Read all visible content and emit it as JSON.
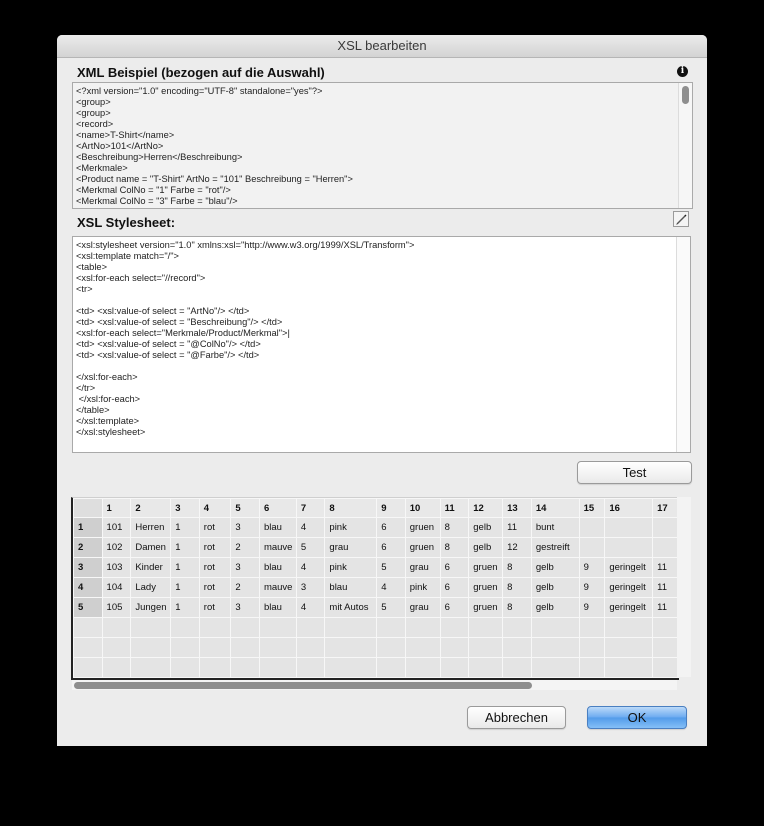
{
  "window": {
    "title": "XSL bearbeiten"
  },
  "xml_section": {
    "label": "XML Beispiel (bezogen auf die Auswahl)",
    "info_icon": "info-icon",
    "lines": [
      "<?xml version=\"1.0\" encoding=\"UTF-8\" standalone=\"yes\"?>",
      "<group>",
      "<group>",
      "<record>",
      "<name>T-Shirt</name>",
      "<ArtNo>101</ArtNo>",
      "<Beschreibung>Herren</Beschreibung>",
      "<Merkmale>",
      "<Product name = \"T-Shirt\" ArtNo = \"101\" Beschreibung = \"Herren\">",
      "<Merkmal ColNo = \"1\" Farbe = \"rot\"/>",
      "<Merkmal ColNo = \"3\" Farbe = \"blau\"/>"
    ]
  },
  "xsl_section": {
    "label": "XSL Stylesheet:",
    "edit_icon": "pencil-icon",
    "lines": [
      "<xsl:stylesheet version=\"1.0\" xmlns:xsl=\"http://www.w3.org/1999/XSL/Transform\">",
      "<xsl:template match=\"/\">",
      "<table>",
      "<xsl:for-each select=\"//record\">",
      "<tr>",
      "",
      "<td> <xsl:value-of select = \"ArtNo\"/> </td>",
      "<td> <xsl:value-of select = \"Beschreibung\"/> </td>",
      "<xsl:for-each select=\"Merkmale/Product/Merkmal\">|",
      "<td> <xsl:value-of select = \"@ColNo\"/> </td>",
      "<td> <xsl:value-of select = \"@Farbe\"/> </td>",
      "",
      "</xsl:for-each>",
      "</tr>",
      " </xsl:for-each>",
      "</table>",
      "</xsl:template>",
      "</xsl:stylesheet>"
    ]
  },
  "buttons": {
    "test": "Test",
    "cancel": "Abbrechen",
    "ok": "OK"
  },
  "result_table": {
    "columns": [
      "1",
      "2",
      "3",
      "4",
      "5",
      "6",
      "7",
      "8",
      "9",
      "10",
      "11",
      "12",
      "13",
      "14",
      "15",
      "16",
      "17"
    ],
    "rows": [
      {
        "label": "1",
        "cells": [
          "101",
          "Herren",
          "1",
          "rot",
          "3",
          "blau",
          "4",
          "pink",
          "6",
          "gruen",
          "8",
          "gelb",
          "11",
          "bunt",
          "",
          "",
          ""
        ]
      },
      {
        "label": "2",
        "cells": [
          "102",
          "Damen",
          "1",
          "rot",
          "2",
          "mauve",
          "5",
          "grau",
          "6",
          "gruen",
          "8",
          "gelb",
          "12",
          "gestreift",
          "",
          "",
          ""
        ]
      },
      {
        "label": "3",
        "cells": [
          "103",
          "Kinder",
          "1",
          "rot",
          "3",
          "blau",
          "4",
          "pink",
          "5",
          "grau",
          "6",
          "gruen",
          "8",
          "gelb",
          "9",
          "geringelt",
          "11"
        ]
      },
      {
        "label": "4",
        "cells": [
          "104",
          "Lady",
          "1",
          "rot",
          "2",
          "mauve",
          "3",
          "blau",
          "4",
          "pink",
          "6",
          "gruen",
          "8",
          "gelb",
          "9",
          "geringelt",
          "11"
        ]
      },
      {
        "label": "5",
        "cells": [
          "105",
          "Jungen",
          "1",
          "rot",
          "3",
          "blau",
          "4",
          "mit Autos",
          "5",
          "grau",
          "6",
          "gruen",
          "8",
          "gelb",
          "9",
          "geringelt",
          "11"
        ]
      }
    ],
    "empty_rows": 3
  },
  "colors": {
    "ok_button": "#529be9",
    "dialog_bg": "#ececec",
    "scroll_thumb": "#8e8e8e"
  }
}
